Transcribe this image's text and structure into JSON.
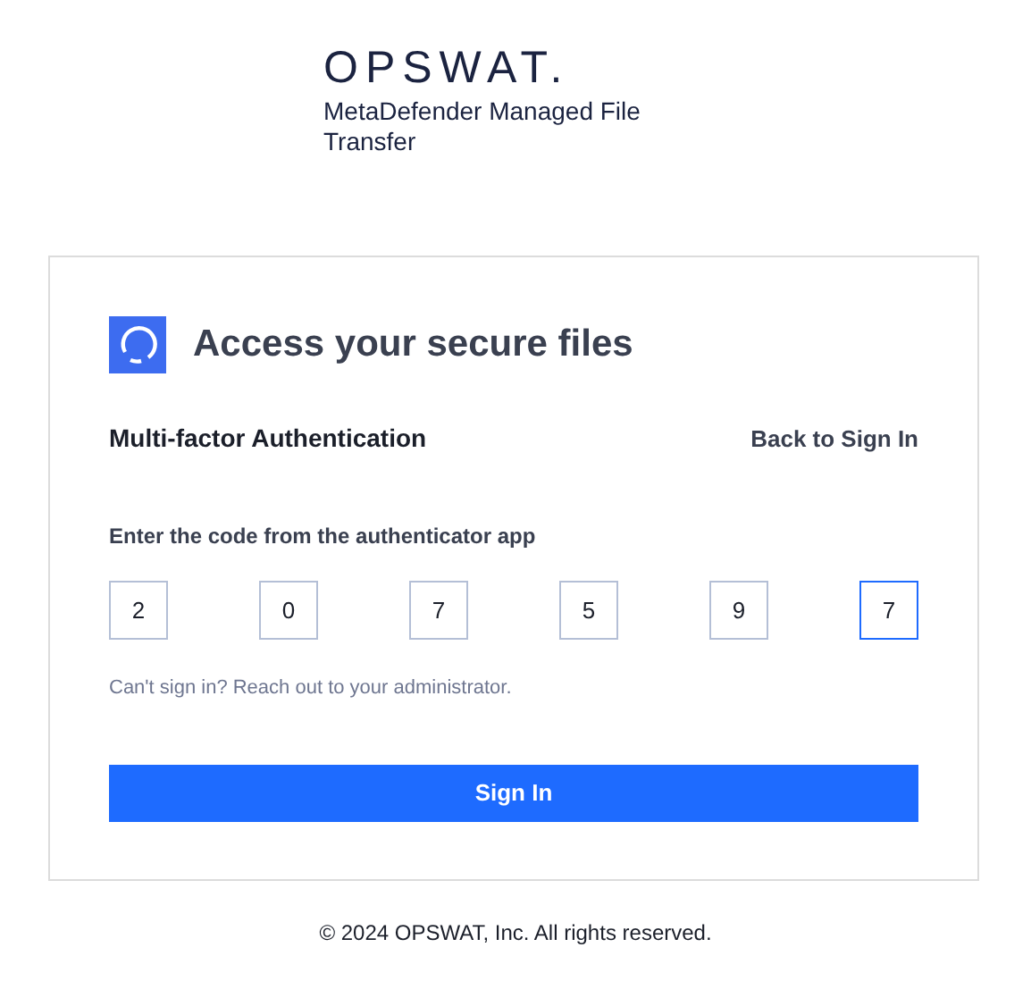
{
  "brand": {
    "logo": "OPSWAT.",
    "product": "MetaDefender Managed File Transfer"
  },
  "card": {
    "title": "Access your secure files",
    "subtitle": "Multi-factor Authentication",
    "back_link": "Back to Sign In",
    "code_label": "Enter the code from the authenticator app",
    "code_digits": [
      {
        "value": "2",
        "focused": false
      },
      {
        "value": "0",
        "focused": false
      },
      {
        "value": "7",
        "focused": false
      },
      {
        "value": "5",
        "focused": false
      },
      {
        "value": "9",
        "focused": false
      },
      {
        "value": "7",
        "focused": true
      }
    ],
    "help": "Can't sign in? Reach out to your administrator.",
    "submit": "Sign In"
  },
  "footer": "© 2024 OPSWAT, Inc. All rights reserved."
}
